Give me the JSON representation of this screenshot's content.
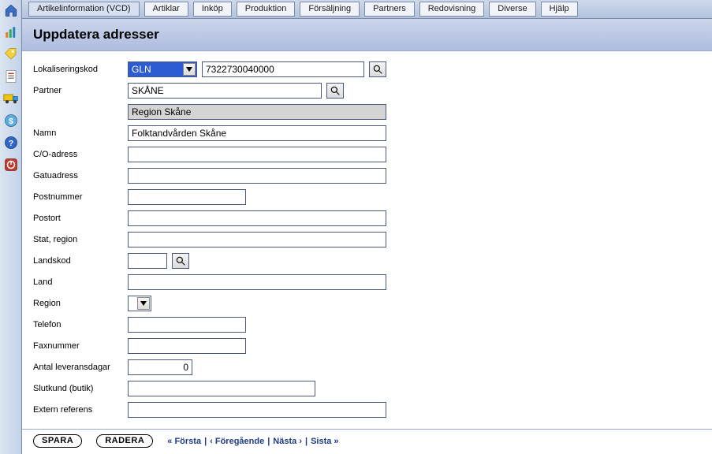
{
  "tabs": [
    "Artikelinformation (VCD)",
    "Artiklar",
    "Inköp",
    "Produktion",
    "Försäljning",
    "Partners",
    "Redovisning",
    "Diverse",
    "Hjälp"
  ],
  "page": {
    "title": "Uppdatera adresser"
  },
  "labels": {
    "lokaliseringskod": "Lokaliseringskod",
    "partner": "Partner",
    "namn": "Namn",
    "co": "C/O-adress",
    "gatuadress": "Gatuadress",
    "postnummer": "Postnummer",
    "postort": "Postort",
    "stat_region": "Stat, region",
    "landskod": "Landskod",
    "land": "Land",
    "region": "Region",
    "telefon": "Telefon",
    "faxnummer": "Faxnummer",
    "antal_lev": "Antal leveransdagar",
    "slutkund": "Slutkund (butik)",
    "extern_ref": "Extern referens"
  },
  "fields": {
    "lok_type": "GLN",
    "lok_value": "7322730040000",
    "partner_code": "SKÅNE",
    "partner_name": "Region Skåne",
    "namn": "Folktandvården Skåne",
    "co": "",
    "gatuadress": "",
    "postnummer": "",
    "postort": "",
    "stat_region": "",
    "landskod": "",
    "land": "",
    "region": "",
    "telefon": "",
    "faxnummer": "",
    "antal_lev": "0",
    "slutkund": "",
    "extern_ref": ""
  },
  "buttons": {
    "spara": "SPARA",
    "radera": "RADERA"
  },
  "pager": {
    "first": "« Första",
    "prev": "‹ Föregående",
    "next": "Nästa ›",
    "last": "Sista »"
  }
}
